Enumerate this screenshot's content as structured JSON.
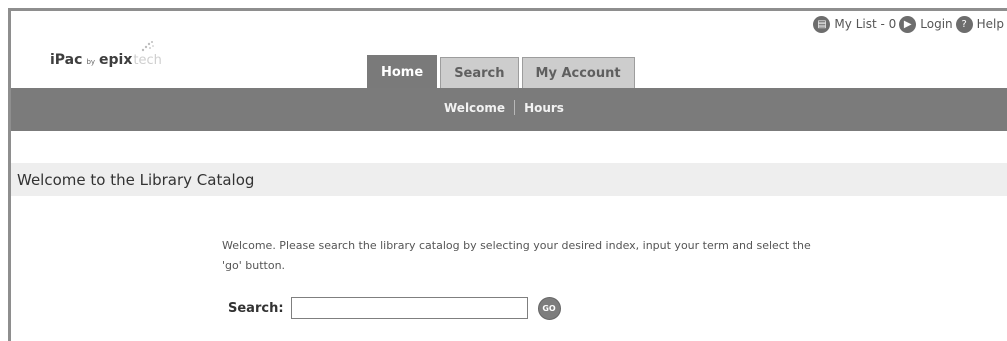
{
  "utility": {
    "my_list_label": "My List - 0",
    "login_label": "Login",
    "help_label": "Help",
    "icons": [
      "list-icon",
      "login-arrow-icon",
      "help-question-icon"
    ]
  },
  "logo": {
    "product": "iPac",
    "by": "by",
    "brand": "epix",
    "brand_suffix": "tech"
  },
  "tabs": [
    {
      "label": "Home",
      "active": true
    },
    {
      "label": "Search",
      "active": false
    },
    {
      "label": "My Account",
      "active": false
    }
  ],
  "subnav": {
    "items": [
      "Welcome",
      "Hours"
    ]
  },
  "main": {
    "heading": "Welcome to the Library Catalog",
    "welcome_text": "Welcome. Please search the library catalog by selecting your desired index, input your term and select the 'go' button.",
    "search": {
      "label": "Search:",
      "value": "",
      "placeholder": "",
      "go_label": "GO"
    }
  },
  "colors": {
    "navbar": "#7b7b7b",
    "tab_active": "#7a7a7a",
    "tab_inactive": "#cdcdcd",
    "heading_bg": "#eeeeee"
  }
}
